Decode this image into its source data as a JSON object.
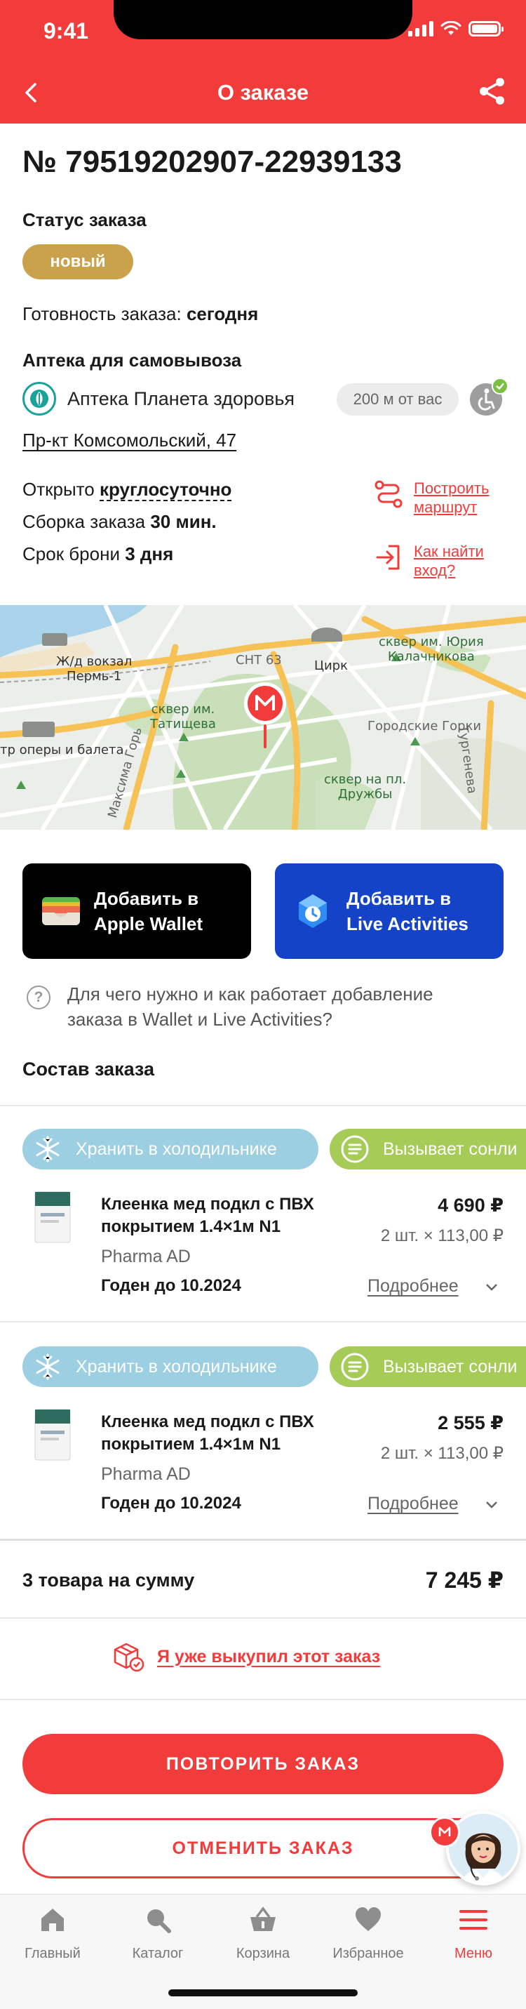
{
  "status_bar": {
    "time": "9:41"
  },
  "header": {
    "title": "О заказе"
  },
  "order": {
    "number": "№ 79519202907-22939133",
    "status_label": "Статус заказа",
    "status_badge": "новый",
    "readiness_label": "Готовность заказа:",
    "readiness_value": "сегодня",
    "pickup_label": "Аптека для самовывоза",
    "pharmacy_name": "Аптека Планета здоровья",
    "distance": "200 м от вас",
    "address": "Пр-кт Комсомольский, 47",
    "open_label": "Открыто",
    "open_value": "круглосуточно",
    "assembly_label": "Сборка заказа",
    "assembly_value": "30 мин.",
    "reserve_label": "Срок брони",
    "reserve_value": "3 дня",
    "route_link_line1": "Построить",
    "route_link_line2": "маршрут",
    "entrance_link_line1": "Как найти",
    "entrance_link_line2": "вход?"
  },
  "map": {
    "labels": {
      "station": "Ж/д вокзал\nПермь-1",
      "snt": "СНТ 63",
      "circus": "Цирк",
      "square_kalachnikova": "сквер им. Юрия\nКалачникова",
      "square_tatishcheva": "сквер им.\nТатищева",
      "gorodskie_gorki": "Городские Горки",
      "turgeneva": "Тургенева",
      "theatre": "тр оперы и балета",
      "maksima_gorkogo": "Максима Горь",
      "square_druzhby": "сквер на пл.\nДружбы"
    }
  },
  "wallet": {
    "apple_line1": "Добавить в",
    "apple_line2": "Apple Wallet",
    "live_line1": "Добавить в",
    "live_line2": "Live Activities",
    "help_text": "Для чего нужно и как работает добавление заказа в Wallet и Live Activities?"
  },
  "composition": {
    "title": "Состав заказа",
    "items": [
      {
        "chip_cold": "Хранить в холодильнике",
        "chip_warning": "Вызывает сонли",
        "name": "Клеенка мед подкл с ПВХ покрытием 1.4×1м N1",
        "maker": "Pharma AD",
        "expiry": "Годен до 10.2024",
        "price": "4 690 ₽",
        "qty": "2 шт. × 113,00 ₽",
        "more": "Подробнее"
      },
      {
        "chip_cold": "Хранить в холодильнике",
        "chip_warning": "Вызывает сонли",
        "name": "Клеенка мед подкл с ПВХ покрытием 1.4×1м N1",
        "maker": "Pharma AD",
        "expiry": "Годен до 10.2024",
        "price": "2 555 ₽",
        "qty": "2 шт. × 113,00 ₽",
        "more": "Подробнее"
      }
    ]
  },
  "summary": {
    "label": "3 товара на сумму",
    "total": "7 245 ₽"
  },
  "actions": {
    "redeemed": "Я уже выкупил этот заказ",
    "repeat": "ПОВТОРИТЬ ЗАКАЗ",
    "cancel": "ОТМЕНИТЬ ЗАКАЗ"
  },
  "tabbar": {
    "items": [
      {
        "label": "Главный",
        "icon": "home-icon"
      },
      {
        "label": "Каталог",
        "icon": "search-icon"
      },
      {
        "label": "Корзина",
        "icon": "basket-icon"
      },
      {
        "label": "Избранное",
        "icon": "heart-icon"
      },
      {
        "label": "Меню",
        "icon": "menu-icon",
        "active": true
      }
    ]
  },
  "colors": {
    "brand": "#f23c3c",
    "badge": "#c9a24b",
    "live_activities": "#1443c8",
    "chip_cold": "#9dcfe2",
    "chip_warning": "#a6cb57"
  }
}
